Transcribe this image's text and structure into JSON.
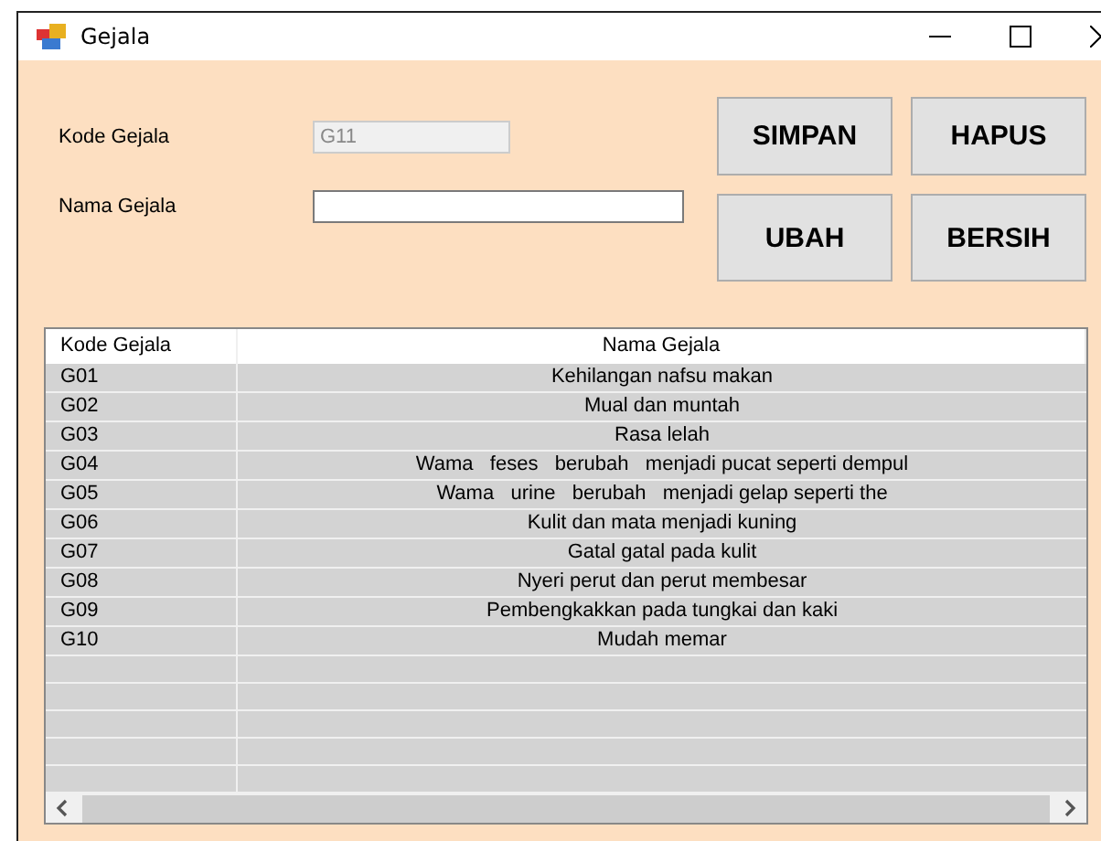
{
  "window": {
    "title": "Gejala"
  },
  "form": {
    "fields": [
      {
        "label": "Kode Gejala",
        "value": "G11",
        "disabled": true
      },
      {
        "label": "Nama Gejala",
        "disabled": false
      }
    ]
  },
  "buttons": [
    "SIMPAN",
    "HAPUS",
    "UBAH",
    "BERSIH"
  ],
  "table": {
    "columns": [
      "Kode Gejala",
      "Nama Gejala"
    ],
    "rows": [
      [
        "G01",
        "Kehilangan nafsu makan"
      ],
      [
        "G02",
        "Mual dan muntah"
      ],
      [
        "G03",
        "Rasa lelah"
      ],
      [
        "G04",
        "Wama   feses   berubah   menjadi pucat seperti dempul"
      ],
      [
        "G05",
        "Wama   urine   berubah   menjadi gelap seperti the"
      ],
      [
        "G06",
        "Kulit dan mata menjadi kuning"
      ],
      [
        "G07",
        "Gatal gatal pada kulit"
      ],
      [
        "G08",
        "Nyeri perut dan perut membesar"
      ],
      [
        "G09",
        "Pembengkakkan pada tungkai dan kaki"
      ],
      [
        "G10",
        "Mudah memar"
      ]
    ]
  }
}
